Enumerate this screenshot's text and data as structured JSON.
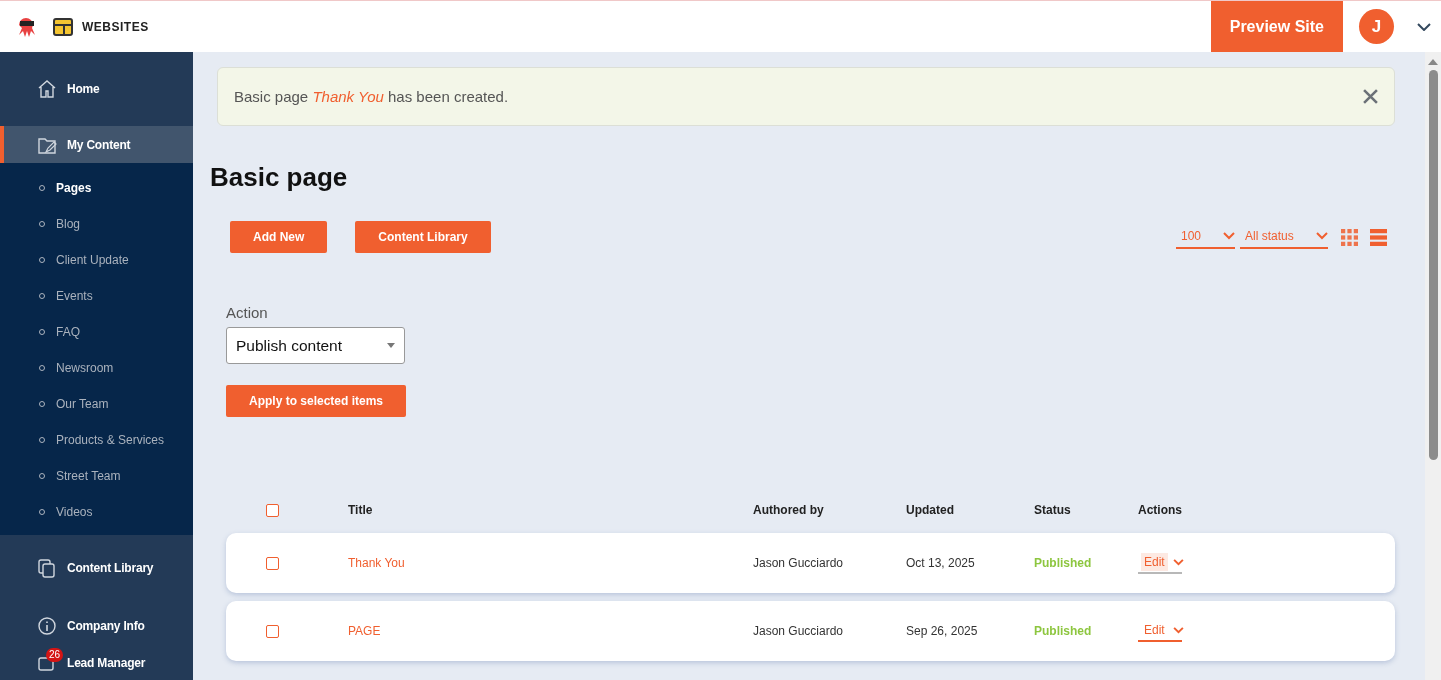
{
  "header": {
    "app": "WEBSITES",
    "preview_button": "Preview Site",
    "avatar": "J"
  },
  "sidebar": {
    "items": [
      {
        "label": "Home",
        "selected": false
      },
      {
        "label": "My Content",
        "selected": true,
        "expanded": true,
        "children": [
          {
            "label": "Pages",
            "selected": true
          },
          {
            "label": "Blog",
            "selected": false
          },
          {
            "label": "Client Update",
            "selected": false
          },
          {
            "label": "Events",
            "selected": false
          },
          {
            "label": "FAQ",
            "selected": false
          },
          {
            "label": "Newsroom",
            "selected": false
          },
          {
            "label": "Our Team",
            "selected": false
          },
          {
            "label": "Products & Services",
            "selected": false
          },
          {
            "label": "Street Team",
            "selected": false
          },
          {
            "label": "Videos",
            "selected": false
          }
        ]
      },
      {
        "label": "Content Library",
        "selected": false
      },
      {
        "label": "Company Info",
        "selected": false
      },
      {
        "label": "Lead Manager",
        "selected": false,
        "badge": "26"
      }
    ]
  },
  "message": "Basic page *Thank You* has been created.",
  "page_title": "Basic page",
  "buttons": [
    "Add New",
    "Content Library"
  ],
  "per_page": "100",
  "status_filter": "All status",
  "view_modes": [
    {
      "kind": "grid",
      "selected": false
    },
    {
      "kind": "list",
      "selected": true
    }
  ],
  "action": {
    "label": "Action",
    "value": "Publish content",
    "apply_button": "Apply to selected items"
  },
  "table": {
    "columns": [
      "Title",
      "Authored by",
      "Updated",
      "Status",
      "Actions"
    ],
    "header_checked": false,
    "rows": [
      {
        "checked": false,
        "title": "Thank You",
        "author": "Jason Gucciardo",
        "updated": "Oct 13, 2025",
        "status": "Published",
        "action": "Edit",
        "hovered": true
      },
      {
        "checked": false,
        "title": "PAGE",
        "author": "Jason Gucciardo",
        "updated": "Sep 26, 2025",
        "status": "Published",
        "action": "Edit",
        "hovered": false
      }
    ]
  }
}
